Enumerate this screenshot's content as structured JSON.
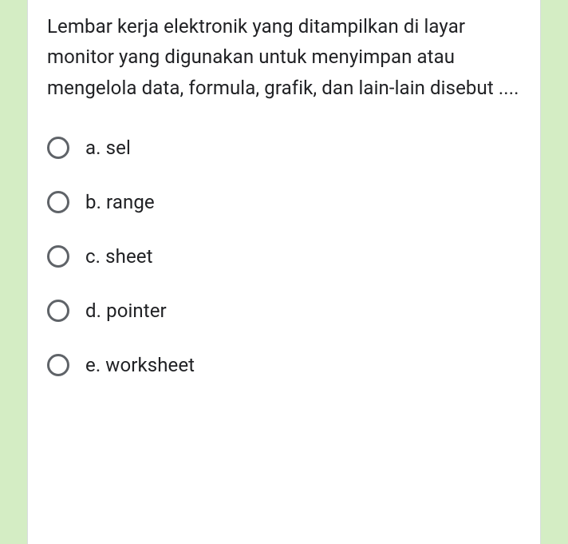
{
  "question": {
    "text": "Lembar kerja elektronik yang ditampilkan di layar monitor yang digunakan untuk menyimpan atau mengelola data, formula, grafik, dan lain-lain disebut ...."
  },
  "options": [
    {
      "label": "a. sel"
    },
    {
      "label": "b. range"
    },
    {
      "label": "c. sheet"
    },
    {
      "label": "d. pointer"
    },
    {
      "label": "e. worksheet"
    }
  ]
}
